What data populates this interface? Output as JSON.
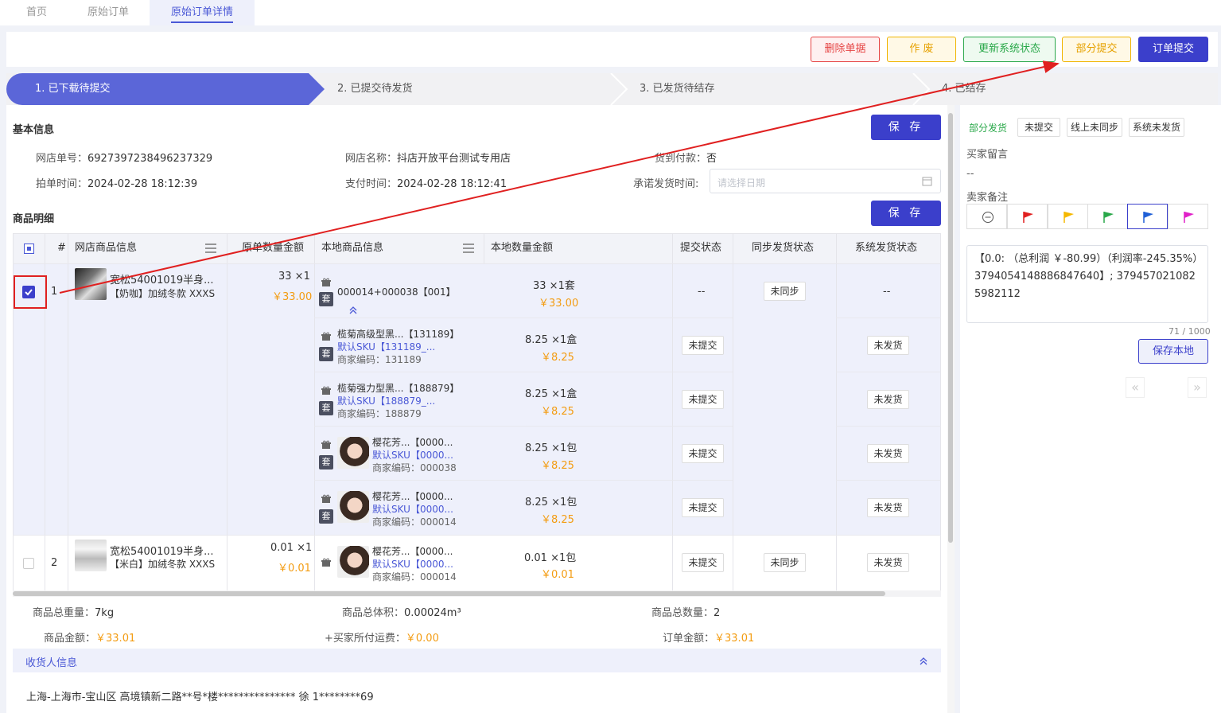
{
  "tabs": [
    "首页",
    "原始订单",
    "原始订单详情"
  ],
  "toolbar": {
    "delete": "删除单据",
    "void": "作 废",
    "update_status": "更新系统状态",
    "partial_submit": "部分提交",
    "order_submit": "订单提交"
  },
  "steps": [
    "1. 已下载待提交",
    "2. 已提交待发货",
    "3. 已发货待结存",
    "4. 已结存"
  ],
  "basic": {
    "title": "基本信息",
    "save": "保 存",
    "shop_no_label": "网店单号：",
    "shop_no": "6927397238496237329",
    "shop_name_label": "网店名称：",
    "shop_name": "抖店开放平台测试专用店",
    "cod_label": "货到付款：",
    "cod": "否",
    "order_time_label": "拍单时间：",
    "order_time": "2024-02-28 18:12:39",
    "pay_time_label": "支付时间：",
    "pay_time": "2024-02-28 18:12:41",
    "promise_label": "承诺发货时间:",
    "promise_placeholder": "请选择日期"
  },
  "goods": {
    "title": "商品明细",
    "save": "保 存",
    "headers": {
      "index": "#",
      "shop_goods": "网店商品信息",
      "orig_qty": "原单数量金额",
      "local_goods": "本地商品信息",
      "local_qty": "本地数量金额",
      "submit_status": "提交状态",
      "sync_status": "同步发货状态",
      "sys_status": "系统发货状态"
    },
    "rows": [
      {
        "index": "1",
        "name": "宽松54001019半身...",
        "spec": "【奶咖】加绒冬款 XXXS",
        "qty": "33 ×1",
        "amount": "￥33.00",
        "sync": "未同步",
        "locals": [
          {
            "name": "000014+000038【001】",
            "qty": "33 ×1套",
            "amount": "￥33.00",
            "submit": "--",
            "sys": "--"
          },
          {
            "name": "榄菊高级型黑...【131189】",
            "sku": "默认SKU【131189_...",
            "code": "商家编码：131189",
            "qty": "8.25 ×1盒",
            "amount": "￥8.25",
            "submit": "未提交",
            "sys": "未发货"
          },
          {
            "name": "榄菊强力型黑...【188879】",
            "sku": "默认SKU【188879_...",
            "code": "商家编码：188879",
            "qty": "8.25 ×1盒",
            "amount": "￥8.25",
            "submit": "未提交",
            "sys": "未发货"
          },
          {
            "name": "樱花芳...【0000...",
            "sku": "默认SKU【0000...",
            "code": "商家编码：000038",
            "qty": "8.25 ×1包",
            "amount": "￥8.25",
            "submit": "未提交",
            "sys": "未发货"
          },
          {
            "name": "樱花芳...【0000...",
            "sku": "默认SKU【0000...",
            "code": "商家编码：000014",
            "qty": "8.25 ×1包",
            "amount": "￥8.25",
            "submit": "未提交",
            "sys": "未发货"
          }
        ]
      },
      {
        "index": "2",
        "name": "宽松54001019半身...",
        "spec": "【米白】加绒冬款 XXXS",
        "qty": "0.01 ×1",
        "amount": "￥0.01",
        "sync": "未同步",
        "locals": [
          {
            "name": "樱花芳...【0000...",
            "sku": "默认SKU【0000...",
            "code": "商家编码：000014",
            "qty": "0.01 ×1包",
            "amount": "￥0.01",
            "submit": "未提交",
            "sys": "未发货"
          }
        ]
      }
    ],
    "tao_label": "套"
  },
  "summary": {
    "weight_label": "商品总重量：",
    "weight": "7kg",
    "volume_label": "商品总体积：",
    "volume": "0.00024m³",
    "count_label": "商品总数量：",
    "count": "2",
    "goods_amount_label": "商品金额：",
    "goods_amount": "￥33.01",
    "freight_label": "+买家所付运费：",
    "freight": "￥0.00",
    "order_amount_label": "订单金额：",
    "order_amount": "￥33.01"
  },
  "receiver": {
    "title": "收货人信息",
    "address": "上海-上海市-宝山区 高境镇新二路**号*楼*************** 徐 1********69"
  },
  "right": {
    "partial": "部分发货",
    "not_submitted": "未提交",
    "online_not_synced": "线上未同步",
    "sys_not_shipped": "系统未发货",
    "buyer_msg_label": "买家留言",
    "buyer_msg": "--",
    "seller_note_label": "卖家备注",
    "remark": "【0.0: （总利润 ￥-80.99）（利润率-245.35%）3794054148886847640】; 3794570210825982112",
    "counter": "71 / 1000",
    "save_local": "保存本地"
  },
  "colors": {
    "primary": "#3b3fcb",
    "orange": "#f39c12",
    "red_flag": "#e02020",
    "yellow_flag": "#f5b800",
    "green_flag": "#2aa84a",
    "blue_flag": "#1f5fd6",
    "pink_flag": "#e020c8"
  }
}
